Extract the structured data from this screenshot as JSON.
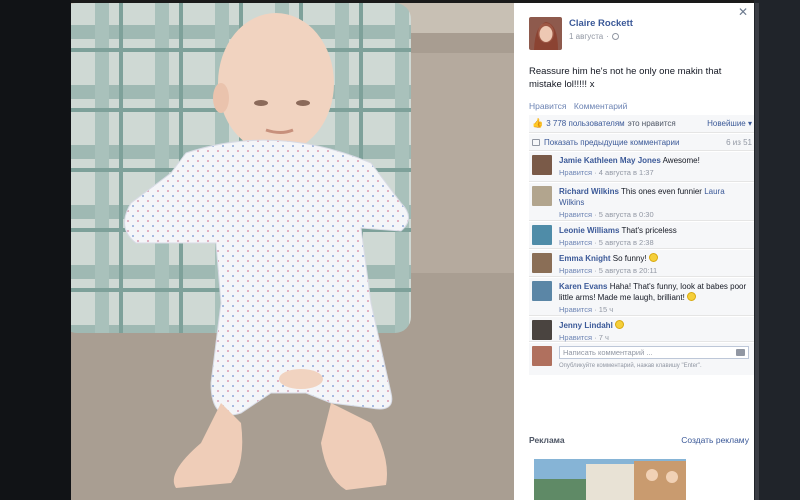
{
  "post": {
    "author": "Claire Rockett",
    "date": "1 августа",
    "text": "Reassure him he's not he only one makin that mistake lol!!!!! x",
    "actions": {
      "like": "Нравится",
      "comment": "Комментарий"
    }
  },
  "likes": {
    "count": "3 778",
    "suffix": "пользователям",
    "text": "это нравится",
    "sort": "Новейшие"
  },
  "previous": {
    "label": "Показать предыдущие комментарии",
    "count": "6 из 51"
  },
  "comments": [
    {
      "name": "Jamie Kathleen May Jones",
      "text": "Awesome!",
      "like": "Нравится",
      "time": "4 августа в 1:37",
      "avatar_color": "#7a5a48"
    },
    {
      "name": "Richard Wilkins",
      "text": "This ones even funnier",
      "link": "Laura Wilkins",
      "like": "Нравится",
      "time": "5 августа в 0:30",
      "avatar_color": "#b2a58e"
    },
    {
      "name": "Leonie Williams",
      "text": "That's priceless",
      "like": "Нравится",
      "time": "5 августа в 2:38",
      "avatar_color": "#4f8ca8"
    },
    {
      "name": "Emma Knight",
      "text": "So funny!",
      "like": "Нравится",
      "time": "5 августа в 20:11",
      "avatar_color": "#8a6e56"
    },
    {
      "name": "Karen Evans",
      "text": "Haha! That's funny, look at babes poor little arms! Made me laugh, brilliant!",
      "like": "Нравится",
      "time": "15 ч",
      "avatar_color": "#5b86a6"
    },
    {
      "name": "Jenny Lindahl",
      "text": "",
      "like": "Нравится",
      "time": "7 ч",
      "avatar_color": "#4a4440"
    }
  ],
  "input": {
    "placeholder": "Написать комментарий ...",
    "hint": "Опубликуйте комментарий, нажав клавишу \"Enter\"."
  },
  "ads": {
    "title": "Реклама",
    "create": "Создать рекламу"
  },
  "icons": [
    "close-icon",
    "globe-icon",
    "thumbs-up-icon",
    "comment-icon",
    "camera-icon",
    "smiley-icon"
  ],
  "colors": {
    "link": "#3b5998",
    "panel_bg": "#f6f7f9",
    "meta": "#9197a3"
  }
}
